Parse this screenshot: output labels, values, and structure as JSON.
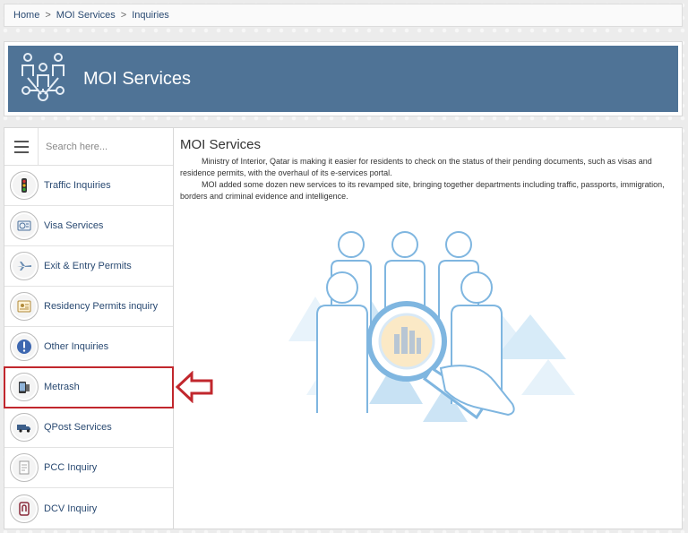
{
  "breadcrumb": {
    "items": [
      "Home",
      "MOI Services",
      "Inquiries"
    ],
    "separator": ">"
  },
  "banner": {
    "title": "MOI Services",
    "color": "#4f7396"
  },
  "sidebar": {
    "search_placeholder": "Search here...",
    "items": [
      {
        "label": "Traffic Inquiries",
        "icon": "traffic-light-icon"
      },
      {
        "label": "Visa Services",
        "icon": "visa-stamp-icon"
      },
      {
        "label": "Exit & Entry Permits",
        "icon": "airplane-icon"
      },
      {
        "label": "Residency Permits inquiry",
        "icon": "residency-card-icon"
      },
      {
        "label": "Other Inquiries",
        "icon": "exclamation-icon"
      },
      {
        "label": "Metrash",
        "icon": "phone-icon"
      },
      {
        "label": "QPost Services",
        "icon": "delivery-truck-icon"
      },
      {
        "label": "PCC Inquiry",
        "icon": "document-icon"
      },
      {
        "label": "DCV Inquiry",
        "icon": "fingerprint-icon"
      }
    ],
    "highlighted": "Metrash"
  },
  "main": {
    "title": "MOI Services",
    "paragraphs": [
      "Ministry of Interior, Qatar is making it easier for residents to check on the status of their pending documents, such as visas and residence permits, with the overhaul of its e-services portal.",
      "MOI added some dozen new services to its revamped site, bringing together departments including traffic, passports, immigration, borders and criminal evidence and intelligence."
    ]
  },
  "annotation": {
    "color": "#c1272d"
  }
}
